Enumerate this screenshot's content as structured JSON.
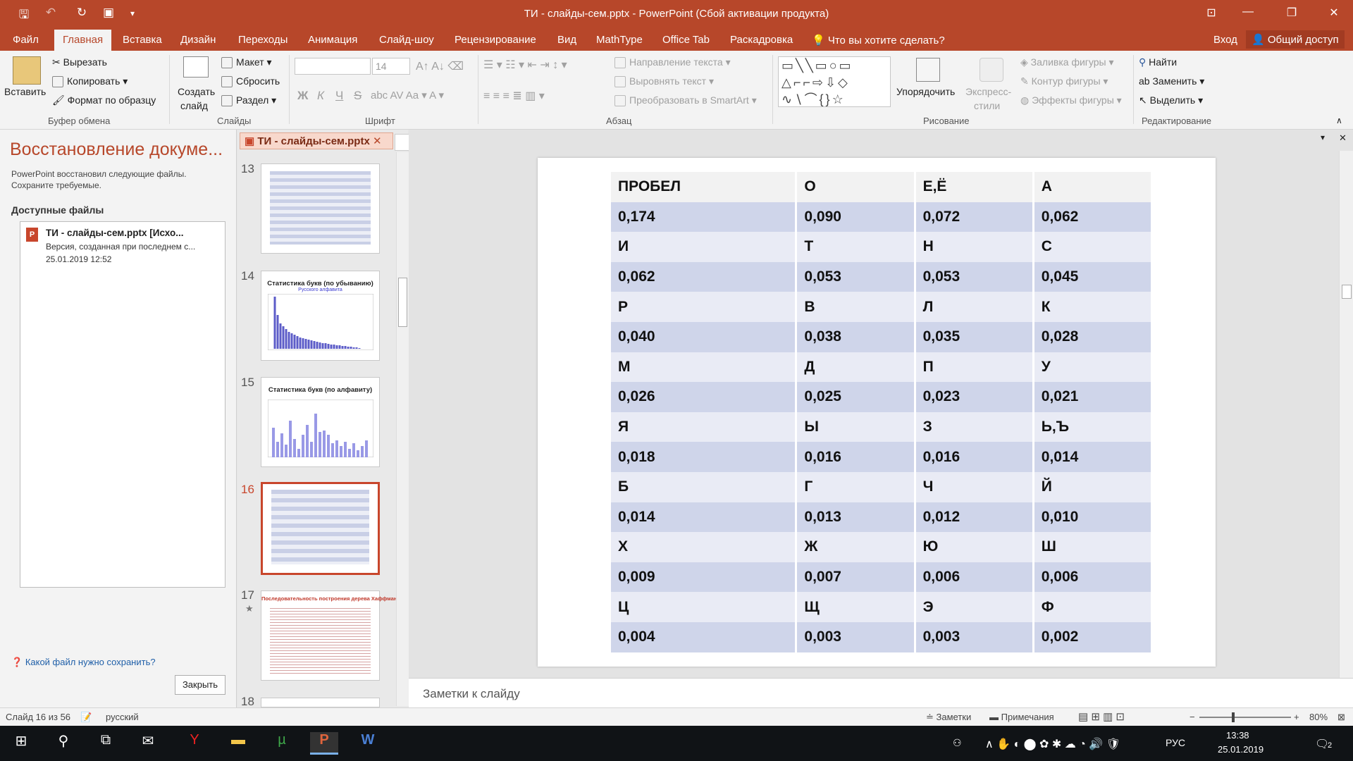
{
  "window": {
    "title": "ТИ - слайды-сем.pptx - PowerPoint (Сбой активации продукта)"
  },
  "tabs": [
    "Файл",
    "Главная",
    "Вставка",
    "Дизайн",
    "Переходы",
    "Анимация",
    "Слайд-шоу",
    "Рецензирование",
    "Вид",
    "MathType",
    "Office Tab",
    "Раскадровка"
  ],
  "tell_me": "Что вы хотите сделать?",
  "signin": "Вход",
  "share": "Общий доступ",
  "ribbon": {
    "paste": "Вставить",
    "cut": "Вырезать",
    "copy": "Копировать",
    "format_painter": "Формат по образцу",
    "g_clipboard": "Буфер обмена",
    "new_slide_1": "Создать",
    "new_slide_2": "слайд",
    "layout": "Макет",
    "reset": "Сбросить",
    "section": "Раздел",
    "g_slides": "Слайды",
    "font_size": "14",
    "bold": "Ж",
    "italic": "К",
    "underline": "Ч",
    "strike": "S",
    "g_font": "Шрифт",
    "text_dir": "Направление текста",
    "align_text": "Выровнять текст",
    "smartart": "Преобразовать в SmartArt",
    "g_paragraph": "Абзац",
    "arrange": "Упорядочить",
    "quick_styles_1": "Экспресс-",
    "quick_styles_2": "стили",
    "shape_fill": "Заливка фигуры",
    "shape_outline": "Контур фигуры",
    "shape_effects": "Эффекты фигуры",
    "g_drawing": "Рисование",
    "find": "Найти",
    "replace": "Заменить",
    "select": "Выделить",
    "g_editing": "Редактирование"
  },
  "recovery": {
    "title": "Восстановление докуме...",
    "desc1": "PowerPoint восстановил следующие файлы.",
    "desc2": "Сохраните требуемые.",
    "available": "Доступные файлы",
    "file_name": "ТИ - слайды-сем.pptx  [Исхо...",
    "file_desc": "Версия, созданная при последнем с...",
    "file_date": "25.01.2019 12:52",
    "help_link": "Какой файл нужно сохранить?",
    "close": "Закрыть"
  },
  "doc_tab": "ТИ - слайды-сем.pptx",
  "thumbs": {
    "n13": "13",
    "n14": "14",
    "n15": "15",
    "n16": "16",
    "n17": "17",
    "n18": "18",
    "t14": "Статистика букв (по убыванию)",
    "s14": "Русского алфавита",
    "t15": "Статистика букв (по алфавиту)",
    "t17": "Последовательность построения дерева Хаффмана"
  },
  "table": [
    [
      "ПРОБЕЛ",
      "О",
      "Е,Ё",
      "А"
    ],
    [
      "0,174",
      "0,090",
      "0,072",
      "0,062"
    ],
    [
      "И",
      "Т",
      "Н",
      "С"
    ],
    [
      "0,062",
      "0,053",
      "0,053",
      "0,045"
    ],
    [
      "Р",
      "В",
      "Л",
      "К"
    ],
    [
      "0,040",
      "0,038",
      "0,035",
      "0,028"
    ],
    [
      "М",
      "Д",
      "П",
      "У"
    ],
    [
      "0,026",
      "0,025",
      "0,023",
      "0,021"
    ],
    [
      "Я",
      "Ы",
      "З",
      "Ь,Ъ"
    ],
    [
      "0,018",
      "0,016",
      "0,016",
      "0,014"
    ],
    [
      "Б",
      "Г",
      "Ч",
      "Й"
    ],
    [
      "0,014",
      "0,013",
      "0,012",
      "0,010"
    ],
    [
      "Х",
      "Ж",
      "Ю",
      "Ш"
    ],
    [
      "0,009",
      "0,007",
      "0,006",
      "0,006"
    ],
    [
      "Ц",
      "Щ",
      "Э",
      "Ф"
    ],
    [
      "0,004",
      "0,003",
      "0,003",
      "0,002"
    ]
  ],
  "notes_placeholder": "Заметки к слайду",
  "status": {
    "slide": "Слайд 16 из 56",
    "lang": "русский",
    "notes": "Заметки",
    "comments": "Примечания",
    "zoom": "80%"
  },
  "taskbar": {
    "lang": "РУС",
    "time": "13:38",
    "date": "25.01.2019",
    "notif": "2"
  },
  "colors": {
    "accent": "#b7472a",
    "row_dark": "#cfd5ea",
    "row_light": "#e9ebf5"
  }
}
